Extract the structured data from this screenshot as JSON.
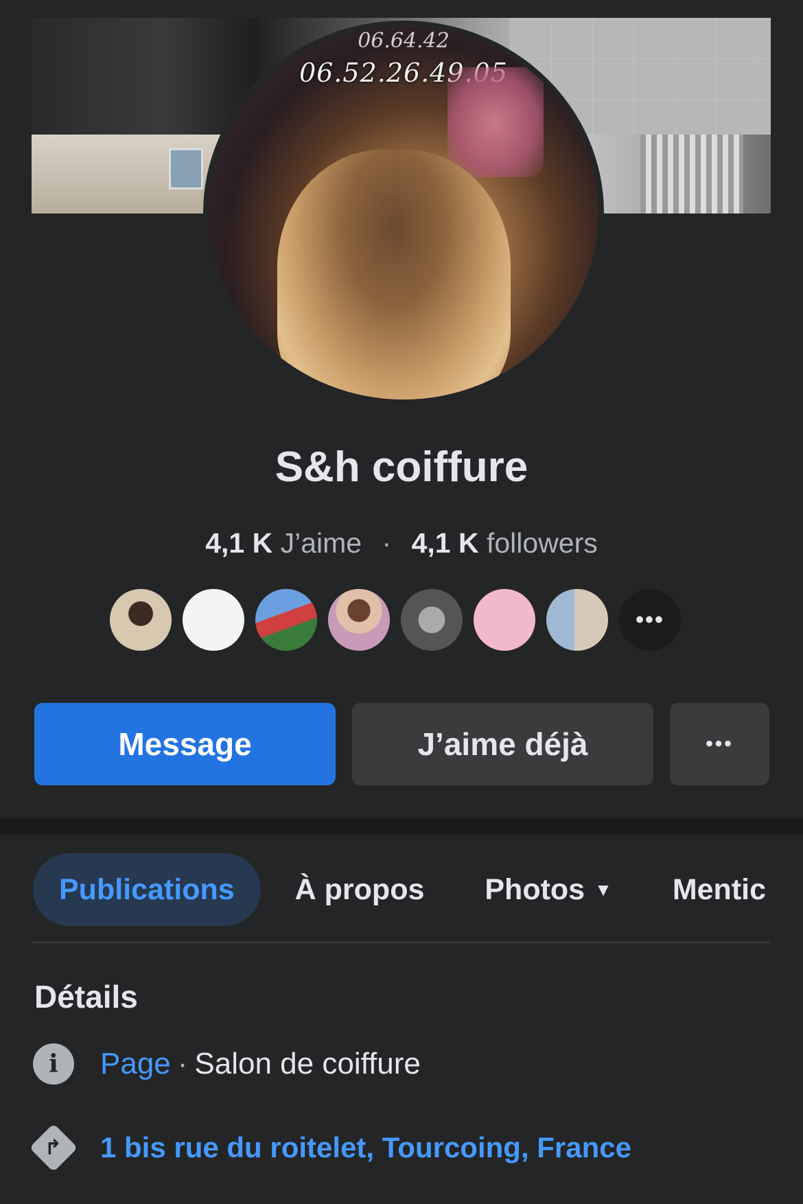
{
  "cover": {
    "phone_partial": "06.64.42",
    "phone": "06.52.26.49.05"
  },
  "profile": {
    "name": "S&h coiffure",
    "likes_count": "4,1 K",
    "likes_label": "J’aime",
    "separator": "·",
    "followers_count": "4,1 K",
    "followers_label": "followers"
  },
  "friends": {
    "avatars": [
      {
        "color": "#c8b49a"
      },
      {
        "color": "#f2f2f2"
      },
      {
        "color": "#5a8ad0"
      },
      {
        "color": "#c79a8a"
      },
      {
        "color": "#7a7a7a"
      },
      {
        "color": "#e7a8c0"
      },
      {
        "color": "#8fa8c4"
      }
    ],
    "more_label": "•••"
  },
  "actions": {
    "message_label": "Message",
    "liked_label": "J’aime déjà",
    "more_label": "•••"
  },
  "tabs": [
    {
      "label": "Publications",
      "active": true
    },
    {
      "label": "À propos",
      "active": false
    },
    {
      "label": "Photos",
      "active": false,
      "icon": "caret-down-icon"
    },
    {
      "label": "Mentic",
      "active": false
    }
  ],
  "details": {
    "heading": "Détails",
    "category_link": "Page",
    "category_sep": "·",
    "category": "Salon de coiffure",
    "address": "1 bis rue du roitelet, Tourcoing, France"
  },
  "colors": {
    "background": "#242526",
    "primary": "#2374e1",
    "link": "#4599ff",
    "active_tab_bg": "#263951"
  }
}
